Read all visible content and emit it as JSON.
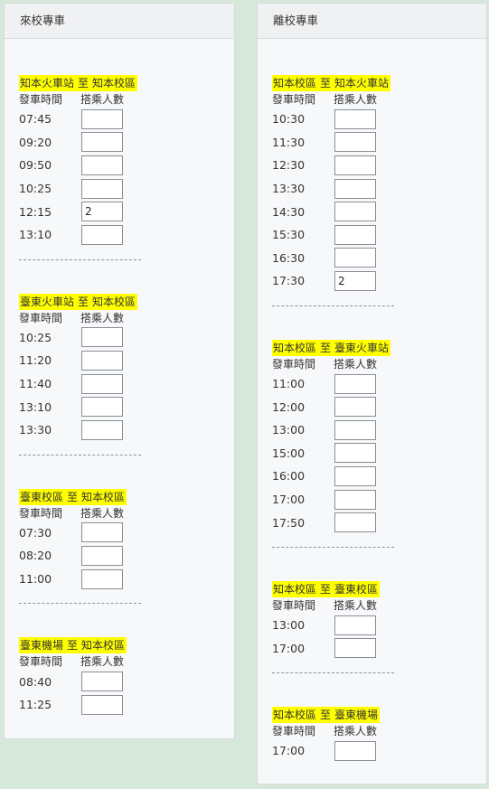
{
  "left_panel": {
    "title": "來校專車",
    "routes": [
      {
        "from": "知本火車站",
        "to_word": "至",
        "to": "知本校區",
        "col_time": "發車時間",
        "col_pax": "搭乘人數",
        "trips": [
          {
            "time": "07:45",
            "value": ""
          },
          {
            "time": "09:20",
            "value": ""
          },
          {
            "time": "09:50",
            "value": ""
          },
          {
            "time": "10:25",
            "value": ""
          },
          {
            "time": "12:15",
            "value": "2"
          },
          {
            "time": "13:10",
            "value": ""
          }
        ]
      },
      {
        "from": "臺東火車站",
        "to_word": "至",
        "to": "知本校區",
        "col_time": "發車時間",
        "col_pax": "搭乘人數",
        "trips": [
          {
            "time": "10:25",
            "value": ""
          },
          {
            "time": "11:20",
            "value": ""
          },
          {
            "time": "11:40",
            "value": ""
          },
          {
            "time": "13:10",
            "value": ""
          },
          {
            "time": "13:30",
            "value": ""
          }
        ]
      },
      {
        "from": "臺東校區",
        "to_word": "至",
        "to": "知本校區",
        "col_time": "發車時間",
        "col_pax": "搭乘人數",
        "trips": [
          {
            "time": "07:30",
            "value": ""
          },
          {
            "time": "08:20",
            "value": ""
          },
          {
            "time": "11:00",
            "value": ""
          }
        ]
      },
      {
        "from": "臺東機場",
        "to_word": "至",
        "to": "知本校區",
        "col_time": "發車時間",
        "col_pax": "搭乘人數",
        "trips": [
          {
            "time": "08:40",
            "value": ""
          },
          {
            "time": "11:25",
            "value": ""
          }
        ]
      }
    ]
  },
  "right_panel": {
    "title": "離校專車",
    "routes": [
      {
        "from": "知本校區",
        "to_word": "至",
        "to": "知本火車站",
        "col_time": "發車時間",
        "col_pax": "搭乘人數",
        "trips": [
          {
            "time": "10:30",
            "value": ""
          },
          {
            "time": "11:30",
            "value": ""
          },
          {
            "time": "12:30",
            "value": ""
          },
          {
            "time": "13:30",
            "value": ""
          },
          {
            "time": "14:30",
            "value": ""
          },
          {
            "time": "15:30",
            "value": ""
          },
          {
            "time": "16:30",
            "value": ""
          },
          {
            "time": "17:30",
            "value": "2"
          }
        ]
      },
      {
        "from": "知本校區",
        "to_word": "至",
        "to": "臺東火車站",
        "col_time": "發車時間",
        "col_pax": "搭乘人數",
        "trips": [
          {
            "time": "11:00",
            "value": ""
          },
          {
            "time": "12:00",
            "value": ""
          },
          {
            "time": "13:00",
            "value": ""
          },
          {
            "time": "15:00",
            "value": ""
          },
          {
            "time": "16:00",
            "value": ""
          },
          {
            "time": "17:00",
            "value": ""
          },
          {
            "time": "17:50",
            "value": ""
          }
        ]
      },
      {
        "from": "知本校區",
        "to_word": "至",
        "to": "臺東校區",
        "col_time": "發車時間",
        "col_pax": "搭乘人數",
        "trips": [
          {
            "time": "13:00",
            "value": ""
          },
          {
            "time": "17:00",
            "value": ""
          }
        ]
      },
      {
        "from": "知本校區",
        "to_word": "至",
        "to": "臺東機場",
        "col_time": "發車時間",
        "col_pax": "搭乘人數",
        "trips": [
          {
            "time": "17:00",
            "value": ""
          }
        ]
      }
    ]
  }
}
